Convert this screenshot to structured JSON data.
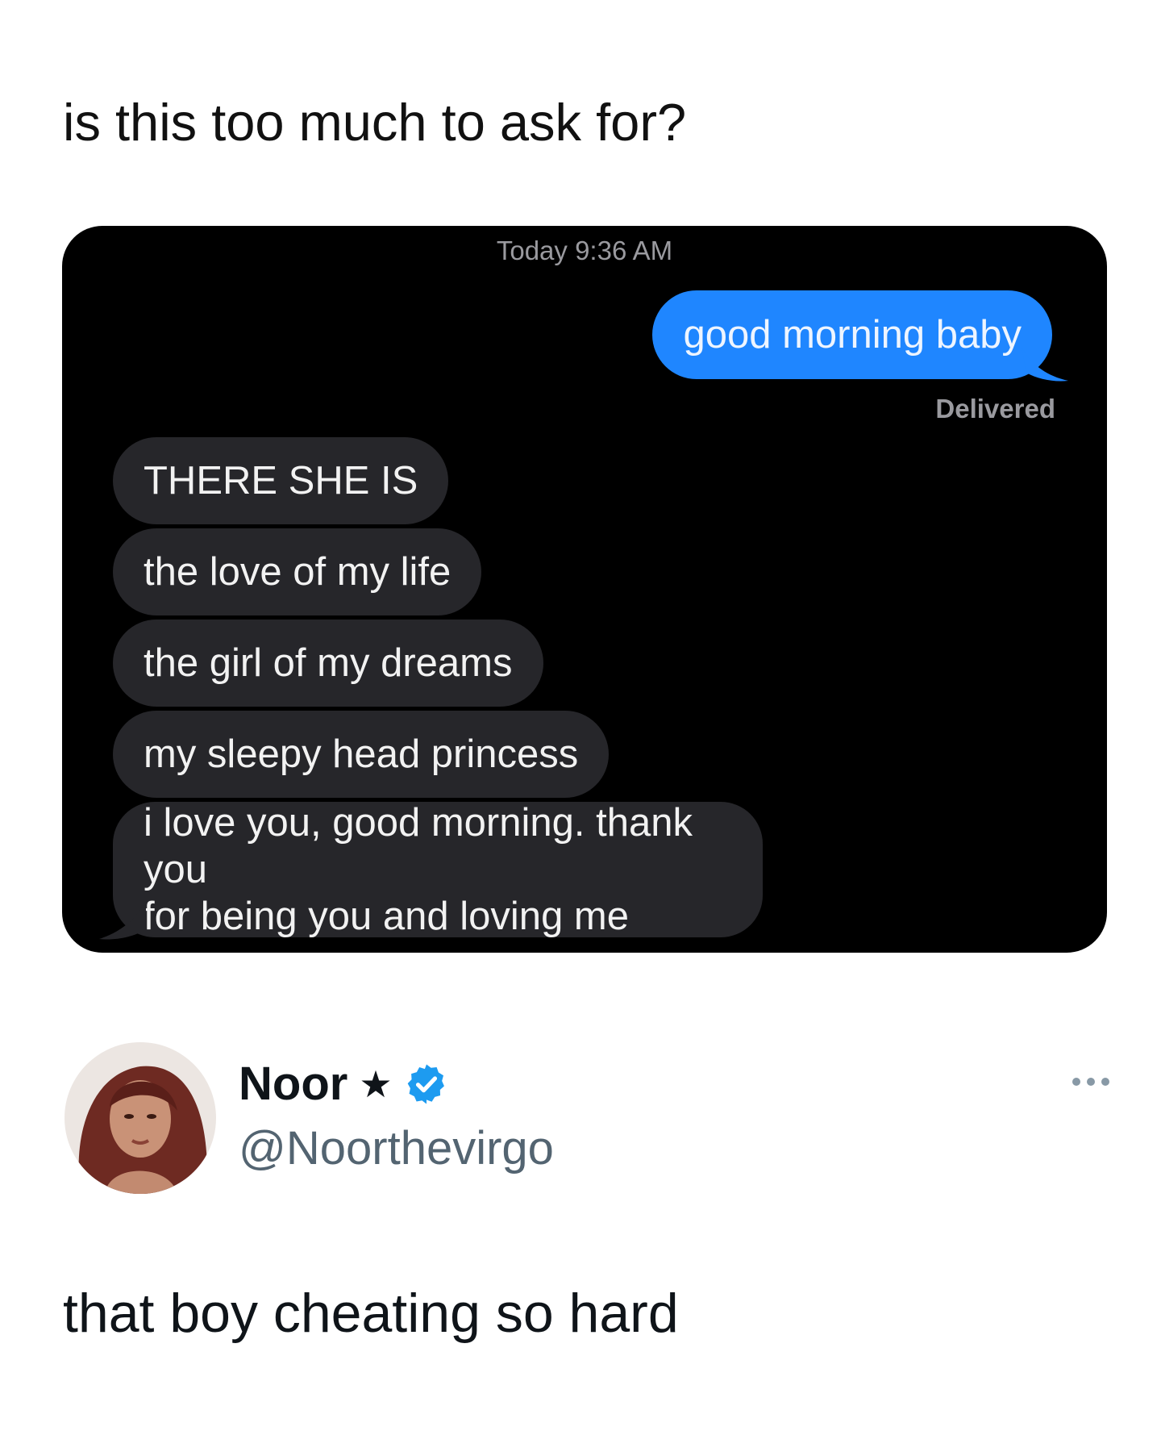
{
  "post": {
    "caption": "is this too much to ask for?"
  },
  "chat": {
    "timestamp": "Today 9:36 AM",
    "outgoing": "good morning baby",
    "status": "Delivered",
    "incoming": [
      "THERE SHE IS",
      "the love of my life",
      "the girl of my dreams",
      "my sleepy head princess"
    ],
    "last_incoming_lines": [
      "i love you, good morning. thank you",
      "for being you and loving me"
    ],
    "colors": {
      "outgoing_bubble": "#1f86ff",
      "incoming_bubble": "#26262a",
      "background": "#000000"
    }
  },
  "tweet": {
    "name": "Noor",
    "name_suffix": "★",
    "handle": "@Noorthevirgo",
    "text": "that boy cheating so hard",
    "verified_color": "#1d9bf0"
  }
}
